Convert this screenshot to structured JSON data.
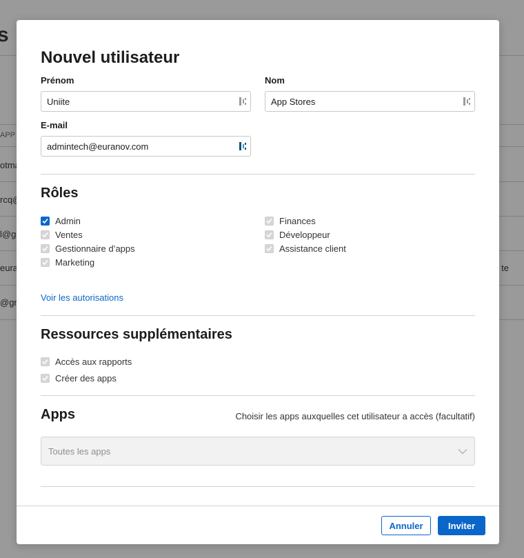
{
  "background": {
    "title_fragment": "s",
    "column_fragment": "APP",
    "rows": [
      "otma",
      "rcq@",
      "l@g",
      "eura",
      "@gn"
    ],
    "row_right": "te"
  },
  "modal": {
    "title": "Nouvel utilisateur",
    "first_name": {
      "label": "Prénom",
      "value": "Uniite"
    },
    "last_name": {
      "label": "Nom",
      "value": "App Stores"
    },
    "email": {
      "label": "E-mail",
      "value": "admintech@euranov.com"
    },
    "roles": {
      "title": "Rôles",
      "left": [
        {
          "label": "Admin",
          "checked": true,
          "disabled": false
        },
        {
          "label": "Ventes",
          "checked": true,
          "disabled": true
        },
        {
          "label": "Gestionnaire d’apps",
          "checked": true,
          "disabled": true
        },
        {
          "label": "Marketing",
          "checked": true,
          "disabled": true
        }
      ],
      "right": [
        {
          "label": "Finances",
          "checked": true,
          "disabled": true
        },
        {
          "label": "Développeur",
          "checked": true,
          "disabled": true
        },
        {
          "label": "Assistance client",
          "checked": true,
          "disabled": true
        }
      ],
      "permissions_link": "Voir les autorisations"
    },
    "resources": {
      "title": "Ressources supplémentaires",
      "items": [
        {
          "label": "Accès aux rapports",
          "checked": true,
          "disabled": true
        },
        {
          "label": "Créer des apps",
          "checked": true,
          "disabled": true
        }
      ]
    },
    "apps": {
      "title": "Apps",
      "hint": "Choisir les apps auxquelles cet utilisateur a accès (facultatif)",
      "select_value": "Toutes les apps"
    },
    "buttons": {
      "cancel": "Annuler",
      "invite": "Inviter"
    }
  },
  "colors": {
    "accent": "#0a66c9",
    "disabled_check": "#d6d6d6"
  }
}
